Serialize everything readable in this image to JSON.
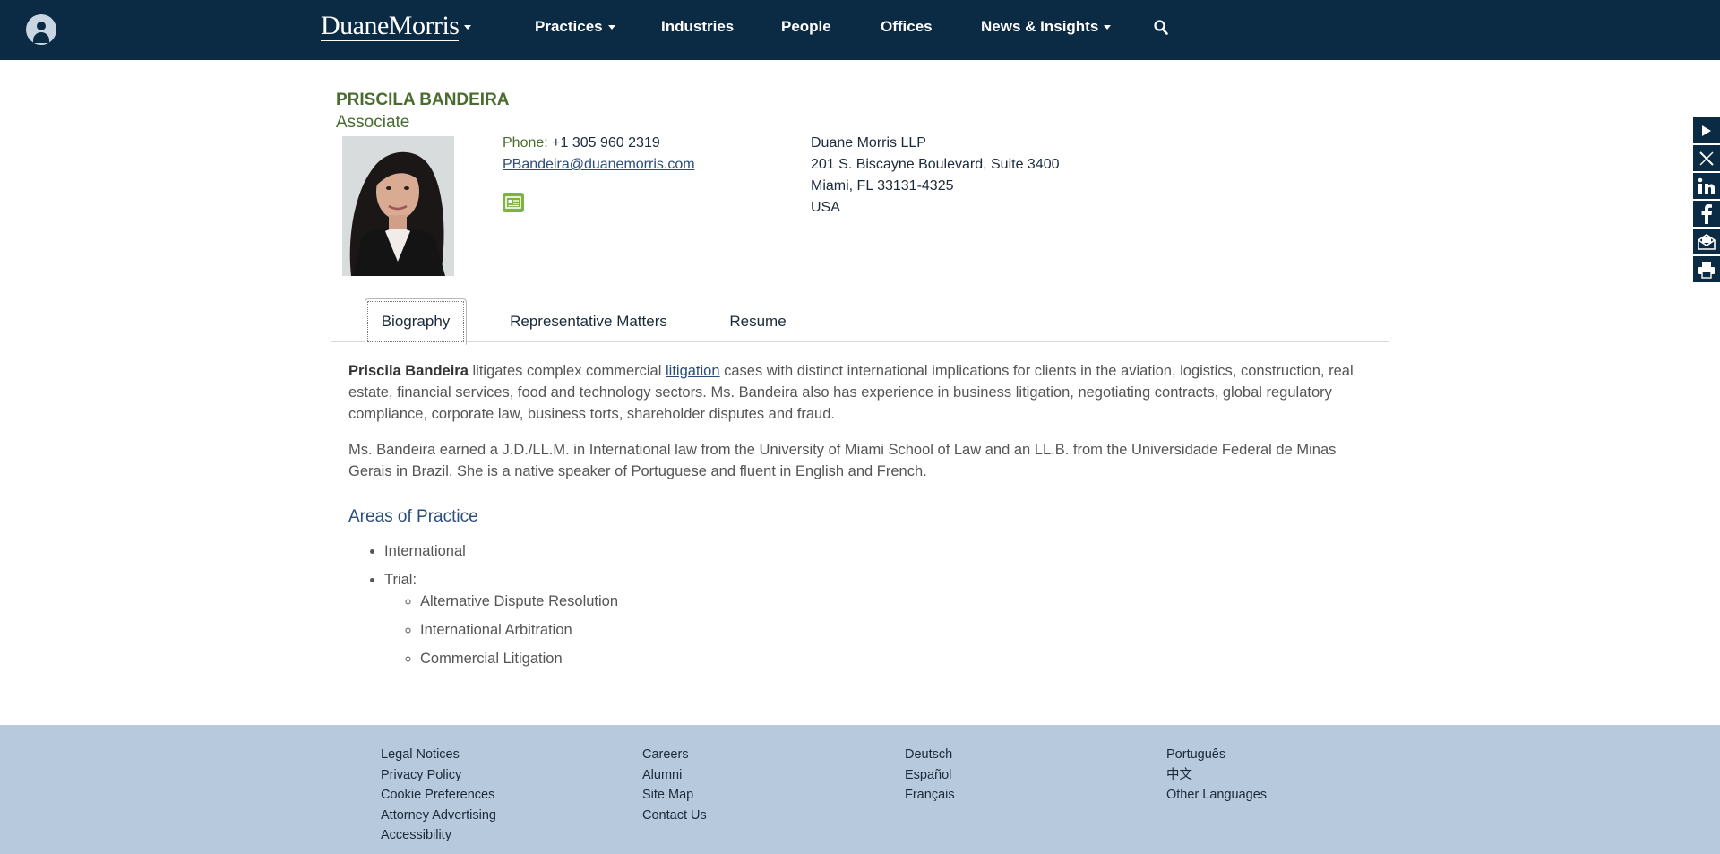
{
  "header": {
    "logo_left": "Duane",
    "logo_right": "Morris",
    "nav": [
      "Practices",
      "Industries",
      "People",
      "Offices",
      "News & Insights"
    ]
  },
  "profile": {
    "name": "PRISCILA BANDEIRA",
    "title": "Associate",
    "phone_label": "Phone:",
    "phone": "+1 305 960 2319",
    "email": "PBandeira@duanemorris.com",
    "address": [
      "Duane Morris LLP",
      "201 S. Biscayne Boulevard, Suite 3400",
      "Miami, FL 33131-4325",
      "USA"
    ]
  },
  "tabs": [
    "Biography",
    "Representative Matters",
    "Resume"
  ],
  "bio": {
    "p1_bold": "Priscila Bandeira",
    "p1_a": " litigates complex commercial ",
    "p1_link": "litigation",
    "p1_b": " cases with distinct international implications for clients in the aviation, logistics, construction, real estate, financial services, food and technology sectors. Ms. Bandeira  also has experience in business litigation, negotiating contracts, global regulatory compliance, corporate law, business torts, shareholder disputes and fraud.",
    "p2": "Ms. Bandeira earned a J.D./LL.M. in International law from the University of Miami School of Law and an LL.B. from the Universidade Federal de Minas Gerais in Brazil. She is a native speaker of Portuguese and fluent in English and French.",
    "aop_heading": "Areas of Practice",
    "aop": [
      "International",
      "Trial:"
    ],
    "aop_trial": [
      "Alternative Dispute Resolution",
      "International Arbitration",
      "Commercial Litigation"
    ]
  },
  "footer": {
    "col1": [
      "Legal Notices",
      "Privacy Policy",
      "Cookie Preferences",
      "Attorney Advertising",
      "Accessibility"
    ],
    "col2": [
      "Careers",
      "Alumni",
      "Site Map",
      "Contact Us"
    ],
    "col3": [
      "Deutsch",
      "Español",
      "Français"
    ],
    "col4": [
      "Português",
      "中文",
      "Other Languages"
    ]
  },
  "colors": {
    "nav_bg": "#0b2a44",
    "name_green": "#4a6d2f",
    "footer_bg": "#b7c9dc",
    "link_blue": "#2a4d7a"
  },
  "icons": [
    "user-icon",
    "search-icon",
    "play-icon",
    "x-icon",
    "linkedin-icon",
    "facebook-icon",
    "email-icon",
    "print-icon",
    "vcard-icon"
  ]
}
